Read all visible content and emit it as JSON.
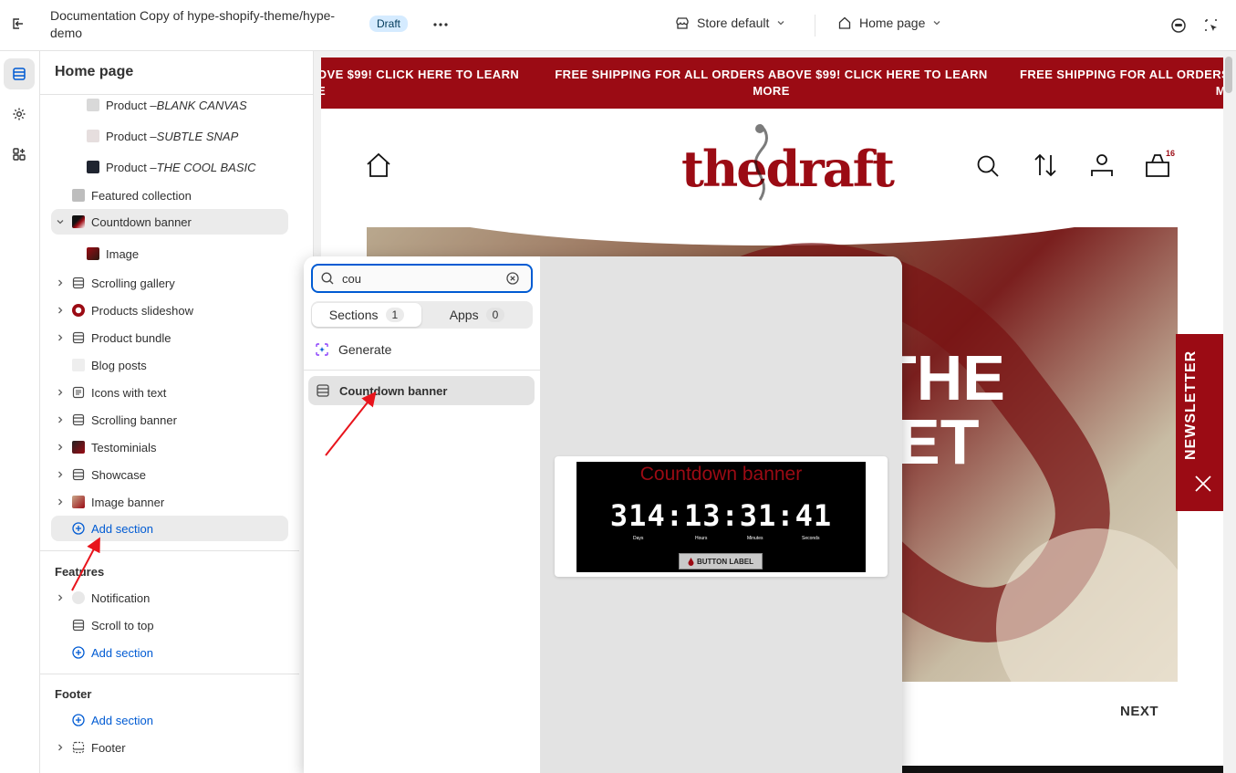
{
  "topbar": {
    "doc_title": "Documentation Copy of hype-shopify-theme/hype-demo",
    "status_badge": "Draft",
    "more": "•••",
    "store_select": "Store default",
    "page_select": "Home page"
  },
  "sidebar": {
    "title": "Home page",
    "template_items": [
      {
        "prefix": "Product – ",
        "emphasis": "BLANK CANVAS"
      },
      {
        "prefix": "Product – ",
        "emphasis": "SUBTLE SNAP"
      },
      {
        "prefix": "Product – ",
        "emphasis": "THE COOL BASIC"
      }
    ],
    "sections": {
      "featured_collection": "Featured collection",
      "countdown_banner": "Countdown banner",
      "image_block": "Image",
      "scrolling_gallery": "Scrolling gallery",
      "products_slideshow": "Products slideshow",
      "product_bundle": "Product bundle",
      "blog_posts": "Blog posts",
      "icons_with_text": "Icons with text",
      "scrolling_banner": "Scrolling banner",
      "testimonials": "Testominials",
      "showcase": "Showcase",
      "image_banner": "Image banner",
      "add_section": "Add section"
    },
    "features": {
      "title": "Features",
      "notification": "Notification",
      "scroll_to_top": "Scroll to top",
      "add_section": "Add section"
    },
    "footer": {
      "title": "Footer",
      "add_section": "Add section",
      "footer": "Footer"
    }
  },
  "popup": {
    "search_value": "cou",
    "tabs": [
      {
        "label": "Sections",
        "count": "1"
      },
      {
        "label": "Apps",
        "count": "0"
      }
    ],
    "generate_label": "Generate",
    "result_label": "Countdown banner",
    "preview": {
      "title": "Countdown banner",
      "digits": "314:13:31:41",
      "units": [
        "Days",
        "Hours",
        "Minutes",
        "Seconds"
      ],
      "button_label": "BUTTON LABEL"
    }
  },
  "storefront": {
    "announcement_left": "OVE $99! CLICK HERE TO LEARN",
    "announcement_left_wrap": "E",
    "announcement_center": "FREE SHIPPING FOR ALL ORDERS ABOVE $99! CLICK HERE TO LEARN MORE",
    "announcement_right": "FREE SHIPPING FOR ALL ORDERS",
    "announcement_right_wrap": "M",
    "logo": "thedraft",
    "cart_count": "16",
    "hero_text_line1": "THE",
    "hero_text_line2": "ET",
    "newsletter_label": "NEWSLETTER",
    "next_label": "NEXT"
  },
  "colors": {
    "brand_red": "#9b0b14",
    "accent_blue": "#005bd3",
    "annotation_arrow": "#e8141c"
  }
}
